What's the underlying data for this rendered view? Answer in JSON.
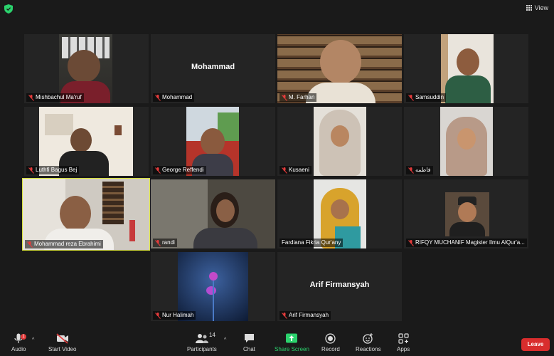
{
  "topbar": {
    "view_label": "View"
  },
  "tiles": [
    {
      "name": "Mishbachul Ma'ruf"
    },
    {
      "name": "Mohammad",
      "big_name": "Mohammad"
    },
    {
      "name": "M. Farhan"
    },
    {
      "name": "Samsuddin"
    },
    {
      "name": "Luthfi Bagus Bej"
    },
    {
      "name": "George Reffendi"
    },
    {
      "name": "Kusaeni"
    },
    {
      "name": "فاطمه"
    },
    {
      "name": "Mohammad reza Ebrahimi"
    },
    {
      "name": "randi"
    },
    {
      "name": "Fardiana Fikria Qur'any"
    },
    {
      "name": "RIFQY MUCHANIF Magister Ilmu AlQur'a..."
    },
    {
      "name": "Nur Halimah"
    },
    {
      "name": "Arif Firmansyah",
      "big_name": "Arif Firmansyah"
    }
  ],
  "toolbar": {
    "audio": "Audio",
    "start_video": "Start Video",
    "participants": "Participants",
    "participants_count": "14",
    "chat": "Chat",
    "share_screen": "Share Screen",
    "record": "Record",
    "reactions": "Reactions",
    "apps": "Apps",
    "leave": "Leave",
    "audio_badge": "1"
  },
  "colors": {
    "accent_green": "#2bd26d",
    "leave_red": "#d92d2d",
    "active_border": "#d8e13d",
    "muted_red": "#e43b3b"
  }
}
